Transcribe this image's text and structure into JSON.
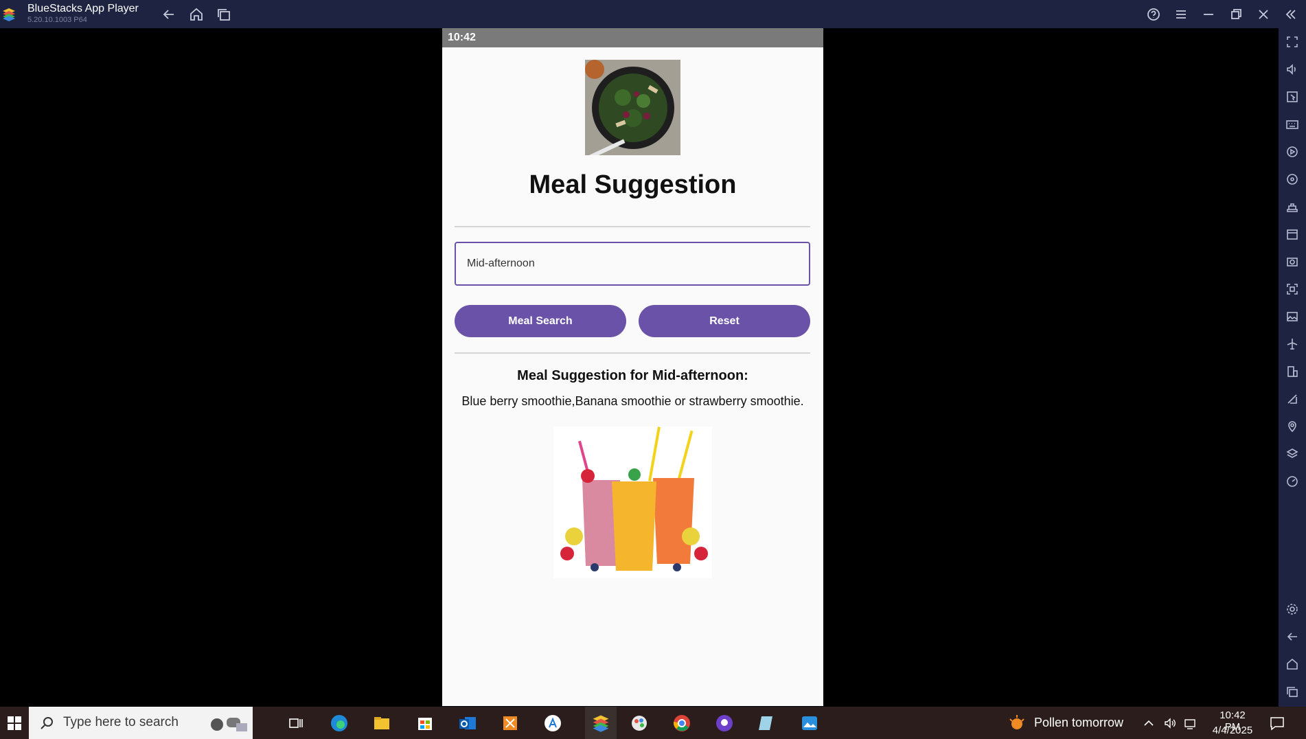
{
  "window": {
    "title": "BlueStacks App Player",
    "version": "5.20.10.1003  P64"
  },
  "android": {
    "status_time": "10:42"
  },
  "app": {
    "title": "Meal Suggestion",
    "input_value": "Mid-afternoon",
    "search_button": "Meal Search",
    "reset_button": "Reset",
    "result_title": "Meal Suggestion for Mid-afternoon:",
    "result_text": "Blue berry smoothie,Banana smoothie or strawberry smoothie."
  },
  "taskbar": {
    "search_placeholder": "Type here to search",
    "weather": "Pollen tomorrow",
    "time": "10:42 PM",
    "date": "4/4/2025"
  },
  "colors": {
    "accent": "#6a52a8",
    "titlebar": "#1d2341"
  }
}
